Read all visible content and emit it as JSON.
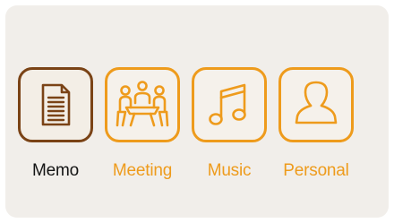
{
  "colors": {
    "accent": "#ee9b1c",
    "selected_border": "#7a4316",
    "selected_label": "#141414",
    "panel_background": "#f1eeea"
  },
  "categories": [
    {
      "label": "Memo",
      "icon": "memo-document-icon",
      "selected": true
    },
    {
      "label": "Meeting",
      "icon": "meeting-people-icon",
      "selected": false
    },
    {
      "label": "Music",
      "icon": "music-note-icon",
      "selected": false
    },
    {
      "label": "Personal",
      "icon": "person-icon",
      "selected": false
    }
  ]
}
